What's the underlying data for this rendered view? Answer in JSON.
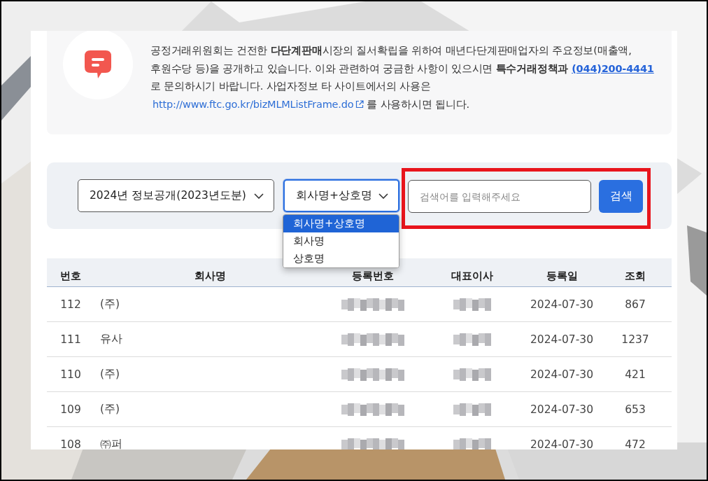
{
  "notice": {
    "segments": [
      {
        "kind": "text",
        "text": "공정거래위원회는 건전한 **다단계판매**시장의 질서확립을 위하여 매년다단계판매업자의 주요정보(매출액,"
      },
      {
        "kind": "break"
      },
      {
        "kind": "text",
        "text": "후원수당 등)을 공개하고 있습니다. 이와 관련하여 궁금한 사항이 있으시면 **특수거래정책과**"
      },
      {
        "kind": "phone",
        "text": "(044)200-4441"
      },
      {
        "kind": "break"
      },
      {
        "kind": "text",
        "text": "로 문의하시기 바랍니다. 사업자정보 타 사이트에서의 사용은"
      },
      {
        "kind": "break"
      },
      {
        "kind": "url",
        "text": "http://www.ftc.go.kr/bizMLMListFrame.do"
      },
      {
        "kind": "text",
        "text": "를 사용하시면 됩니다."
      }
    ]
  },
  "search": {
    "year_select": {
      "value": "2024년 정보공개(2023년도분)"
    },
    "type_select": {
      "value": "회사명+상호명",
      "focused": true,
      "expanded": true,
      "options": [
        {
          "label": "회사명+상호명",
          "selected": true
        },
        {
          "label": "회사명",
          "selected": false
        },
        {
          "label": "상호명",
          "selected": false
        }
      ]
    },
    "search_input": {
      "placeholder": "검색어를 입력해주세요"
    },
    "search_button": "검색",
    "highlighted": true
  },
  "table": {
    "columns": [
      "번호",
      "회사명",
      "등록번호",
      "대표이사",
      "등록일",
      "조회"
    ],
    "rows": [
      {
        "no": "112",
        "company": "(주)",
        "date": "2024-07-30",
        "views": "867"
      },
      {
        "no": "111",
        "company": "유사",
        "date": "2024-07-30",
        "views": "1237"
      },
      {
        "no": "110",
        "company": "(주)",
        "date": "2024-07-30",
        "views": "421"
      },
      {
        "no": "109",
        "company": "(주)",
        "date": "2024-07-30",
        "views": "653"
      },
      {
        "no": "108",
        "company": "㈜퍼",
        "date": "2024-07-30",
        "views": "472"
      }
    ]
  }
}
